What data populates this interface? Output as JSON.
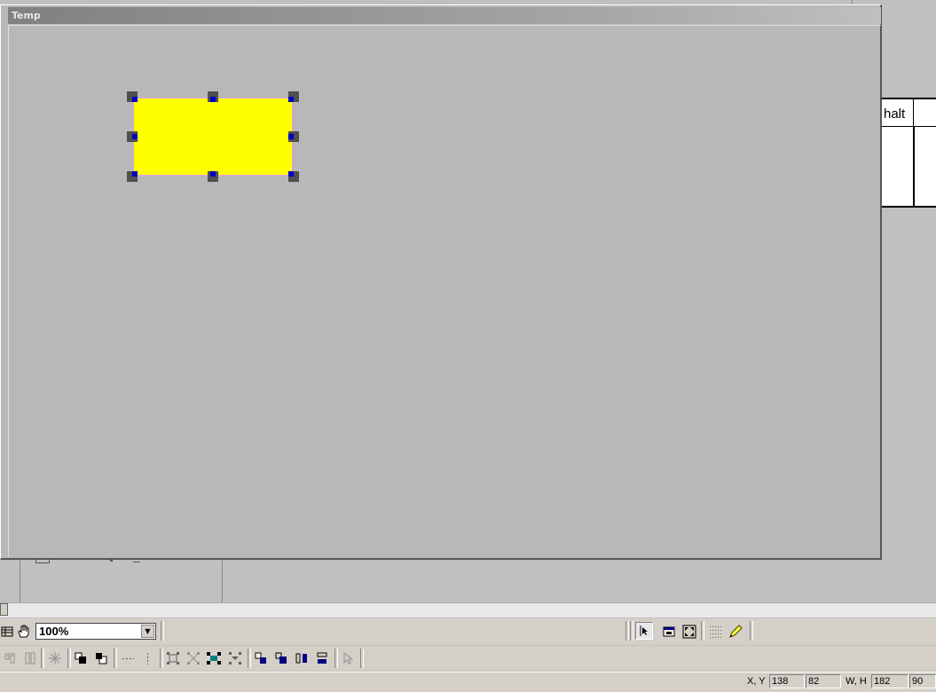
{
  "window": {
    "title": "Temp"
  },
  "background": {
    "table_header_fragment": "halt"
  },
  "toolbar": {
    "zoom_value": "100%",
    "icons_row1": [
      "grid-icon",
      "hand-icon"
    ],
    "icons_row1_right": [
      "pointer-icon",
      "window-icon",
      "fullscreen-icon",
      "dotted-grid-icon",
      "pencil-icon"
    ],
    "icons_row2": [
      "align-top-icon",
      "align-columns-icon",
      "snap-icon",
      "bring-forward-icon",
      "send-backward-icon",
      "horizontal-dots-icon",
      "vertical-dots-icon",
      "group-icon",
      "ungroup-icon",
      "distribute-icon",
      "stretch-icon",
      "rotate-left-icon",
      "rotate-right-icon",
      "flip-horizontal-icon",
      "flip-vertical-icon",
      "pointer-disabled-icon"
    ]
  },
  "status": {
    "xy_label": "X, Y",
    "x": "138",
    "y": "82",
    "wh_label": "W, H",
    "w": "182",
    "h": "90"
  },
  "colors": {
    "shape_fill": "#ffff00",
    "handle_color": "#505050",
    "handle_inner": "#0000c0"
  }
}
